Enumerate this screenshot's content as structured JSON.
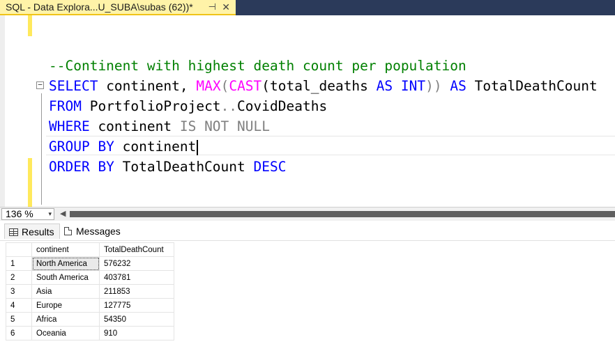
{
  "tab": {
    "title": "SQL - Data Explora...U_SUBA\\subas (62))*",
    "pin_icon": "pin-icon",
    "close_icon": "close-icon",
    "pin_glyph": "⊣",
    "close_glyph": "✕"
  },
  "editor": {
    "comment": "--Continent with highest death count per population",
    "line_select": {
      "kw_select": "SELECT",
      "col": " continent, ",
      "fn_max": "MAX",
      "p1": "(",
      "fn_cast": "CAST",
      "p2": "(total_deaths ",
      "kw_as1": "AS",
      "sp1": " ",
      "kw_int": "INT",
      "p3": ")) ",
      "kw_as2": "AS",
      "alias": " TotalDeathCount"
    },
    "line_from": {
      "kw": "FROM",
      "rest": " PortfolioProject",
      "dots": "..",
      "table": "CovidDeaths"
    },
    "line_where": {
      "kw": "WHERE",
      "rest": " continent ",
      "cond": "IS NOT NULL"
    },
    "line_group": {
      "kw": "GROUP BY",
      "rest": " continent"
    },
    "line_order": {
      "kw": "ORDER BY",
      "rest": " TotalDeathCount ",
      "dir": "DESC"
    },
    "collapse_glyph": "−"
  },
  "zoom": {
    "value": "136 %",
    "dropdown_glyph": "▾",
    "scroll_left_glyph": "◀"
  },
  "results_tabs": {
    "results": "Results",
    "messages": "Messages"
  },
  "results": {
    "columns": [
      "continent",
      "TotalDeathCount"
    ],
    "rows": [
      [
        "1",
        "North America",
        "576232"
      ],
      [
        "2",
        "South America",
        "403781"
      ],
      [
        "3",
        "Asia",
        "211853"
      ],
      [
        "4",
        "Europe",
        "127775"
      ],
      [
        "5",
        "Africa",
        "54350"
      ],
      [
        "6",
        "Oceania",
        "910"
      ]
    ]
  },
  "colors": {
    "keyword": "#0000ff",
    "function": "#ff00ff",
    "comment": "#008000",
    "operator_gray": "#808080",
    "tab_active": "#fff3a8",
    "tab_strip": "#2b3a5a"
  }
}
